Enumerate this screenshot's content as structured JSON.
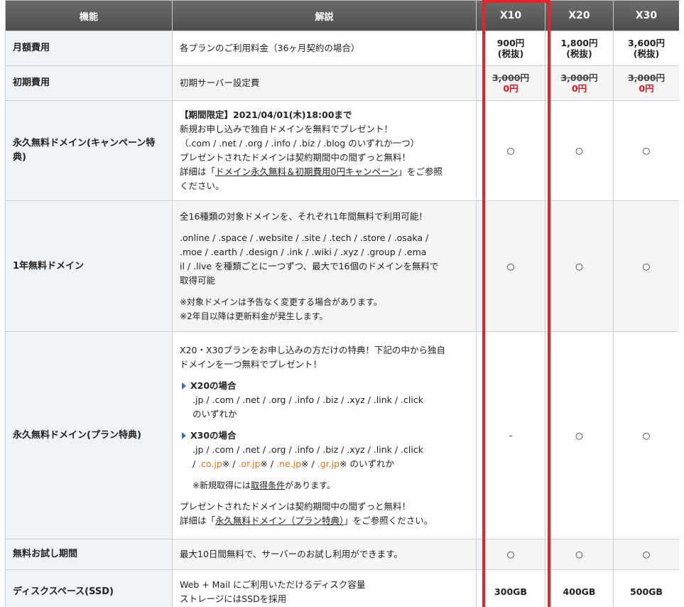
{
  "header": {
    "feature": "機能",
    "description": "解説",
    "x10": "X10",
    "x20": "X20",
    "x30": "X30"
  },
  "rows": {
    "monthly": {
      "label": "月額費用",
      "desc": "各プランのご利用料金（36ヶ月契約の場合）",
      "x10": "900円",
      "x20": "1,800円",
      "x30": "3,600円",
      "tax": "(税抜)"
    },
    "initial": {
      "label": "初期費用",
      "desc": "初期サーバー設定費",
      "old": "3,000円",
      "new": "0円"
    },
    "campaign": {
      "label": "永久無料ドメイン(キャンペーン特典)",
      "line1": "【期間限定】2021/04/01(木)18:00まで",
      "line2": "新規お申し込みで独自ドメインを無料でプレゼント！",
      "line3": "（.com / .net / .org / .info / .biz / .blog のいずれか一つ）",
      "line4": "プレゼントされたドメインは契約期間中の間ずっと無料！",
      "line5a": "詳細は「",
      "line5link": "ドメイン永久無料＆初期費用0円キャンペーン",
      "line5b": "」をご参照",
      "line6": "ください。",
      "x10": "○",
      "x20": "○",
      "x30": "○"
    },
    "oneyear": {
      "label": "1年無料ドメイン",
      "line1": "全16種類の対象ドメインを、それぞれ1年間無料で利用可能！",
      "line2": ".online / .space / .website / .site / .tech / .store / .osaka /",
      "line3": ".moe / .earth / .design / .ink / .wiki / .xyz / .group / .ema",
      "line4": "il / .live を種類ごとに一つずつ、最大で16個のドメインを無料で",
      "line5": "取得可能",
      "note1": "※対象ドメインは予告なく変更する場合があります。",
      "note2": "※2年目以降は更新料金が発生します。",
      "x10": "○",
      "x20": "○",
      "x30": "○"
    },
    "plan": {
      "label": "永久無料ドメイン(プラン特典)",
      "line1": "X20・X30プランをお申し込みの方だけの特典！下記の中から独自",
      "line2": "ドメインを一つ無料でプレゼント！",
      "x20title": "X20の場合",
      "x20line1": ".jp / .com / .net / .org / .info / .biz / .xyz / .link / .click",
      "x20line2": "のいずれか",
      "x30title": "X30の場合",
      "x30line1": ".jp / .com / .net / .org / .info / .biz / .xyz / .link / .click",
      "x30sep1": "/ ",
      "x30co": ".co.jp",
      "x30sep2": "※ / ",
      "x30or": ".or.jp",
      "x30sep3": "※ / ",
      "x30ne": ".ne.jp",
      "x30sep4": "※ / ",
      "x30gr": ".gr.jp",
      "x30end": "※ のいずれか",
      "cond_a": "※新規取得には",
      "cond_link": "取得条件",
      "cond_b": "があります。",
      "end1": "プレゼントされたドメインは契約期間中の間ずっと無料！",
      "end2a": "詳細は「",
      "end2link": "永久無料ドメイン（プラン特典）",
      "end2b": "」をご参照ください。",
      "x10": "-",
      "x20": "○",
      "x30": "○"
    },
    "trial": {
      "label": "無料お試し期間",
      "desc": "最大10日間無料で、サーバーのお試し利用ができます。",
      "x10": "○",
      "x20": "○",
      "x30": "○"
    },
    "disk": {
      "label": "ディスクスペース(SSD)",
      "line1": "Web + Mail にご利用いただけるディスク容量",
      "line2": "ストレージにはSSDを採用",
      "x10": "300GB",
      "x20": "400GB",
      "x30": "500GB"
    }
  },
  "colors": {
    "highlight": "#e8222a",
    "price_red": "#e0141e",
    "orange_link": "#e8741a"
  }
}
